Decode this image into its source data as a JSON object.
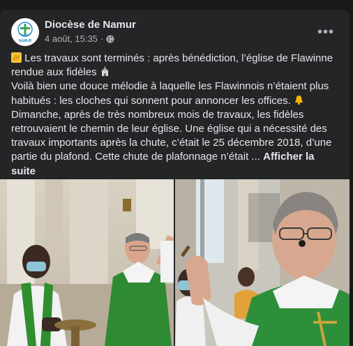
{
  "post": {
    "page_name": "Diocèse de Namur",
    "date": "4 août, 15:35",
    "separator": "·",
    "more_label": "•••",
    "text_lines": [
      "Les travaux sont terminés : après bénédiction, l’église de Flawinne",
      "rendue aux fidèles",
      "Voilà bien une douce mélodie à laquelle les Flawinnois n’étaient plus",
      "habitués : les cloches qui sonnent pour annoncer les offices.",
      "Dimanche, après de très nombreux mois de travaux, les fidèles",
      "retrouvaient le chemin de leur église. Une église qui a nécessité des",
      "travaux importants après la chute, c’était le 25 décembre 2018, d’une",
      "partie du plafond. Cette chute de plafonnage n’était ..."
    ],
    "see_more_1": "Afficher la",
    "see_more_2": "suite"
  },
  "avatar": {
    "label": "NAMUR"
  },
  "icons": [
    "globe-icon",
    "more-options-icon",
    "sparkles-emoji-icon",
    "church-emoji-icon",
    "bell-emoji-icon"
  ],
  "colors": {
    "background": "#18191a",
    "card": "#242526",
    "text": "#e4e6eb",
    "secondary": "#b0b3b8"
  }
}
